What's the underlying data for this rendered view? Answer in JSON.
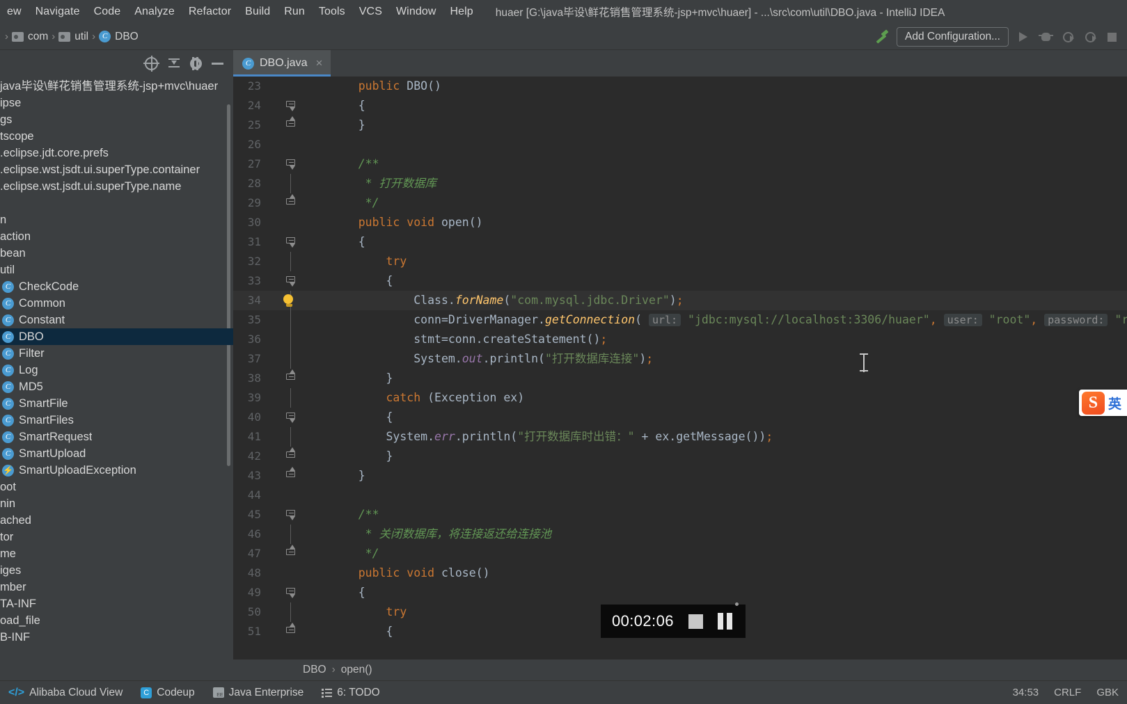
{
  "window": {
    "title": "huaer [G:\\java毕设\\鲜花销售管理系统-jsp+mvc\\huaer] - ...\\src\\com\\util\\DBO.java - IntelliJ IDEA"
  },
  "menubar": {
    "items": [
      {
        "label": "ew"
      },
      {
        "label": "Navigate"
      },
      {
        "label": "Code"
      },
      {
        "label": "Analyze"
      },
      {
        "label": "Refactor"
      },
      {
        "label": "Build"
      },
      {
        "label": "Run"
      },
      {
        "label": "Tools"
      },
      {
        "label": "VCS"
      },
      {
        "label": "Window"
      },
      {
        "label": "Help"
      }
    ]
  },
  "breadcrumb": {
    "items": [
      {
        "label": "com",
        "icon": "folder-icon"
      },
      {
        "label": "util",
        "icon": "folder-icon"
      },
      {
        "label": "DBO",
        "icon": "java-class-icon"
      }
    ]
  },
  "toolbar": {
    "build_icon": "hammer-icon",
    "add_configuration_label": "Add Configuration...",
    "run_icon": "run-icon",
    "debug_icon": "debug-icon",
    "run_with_coverage_icon": "run-coverage-icon",
    "profile_icon": "profile-icon",
    "stop_icon": "stop-icon"
  },
  "project_panel": {
    "toolbar_icons": [
      "locate-icon",
      "collapse-all-icon",
      "gear-icon",
      "hide-icon"
    ],
    "tree": [
      {
        "label": "java毕设\\鲜花销售管理系统-jsp+mvc\\huaer",
        "type": "root",
        "selected": false
      },
      {
        "label": "ipse",
        "type": "folder",
        "selected": false
      },
      {
        "label": "gs",
        "type": "folder",
        "selected": false
      },
      {
        "label": "tscope",
        "type": "file",
        "selected": false
      },
      {
        "label": ".eclipse.jdt.core.prefs",
        "type": "file",
        "selected": false
      },
      {
        "label": ".eclipse.wst.jsdt.ui.superType.container",
        "type": "file",
        "selected": false
      },
      {
        "label": ".eclipse.wst.jsdt.ui.superType.name",
        "type": "file",
        "selected": false
      },
      {
        "label": "",
        "type": "blank",
        "selected": false
      },
      {
        "label": "n",
        "type": "folder",
        "selected": false
      },
      {
        "label": "action",
        "type": "folder",
        "selected": false
      },
      {
        "label": "bean",
        "type": "folder",
        "selected": false
      },
      {
        "label": "util",
        "type": "folder",
        "selected": false
      },
      {
        "label": "CheckCode",
        "type": "class",
        "selected": false
      },
      {
        "label": "Common",
        "type": "class",
        "selected": false
      },
      {
        "label": "Constant",
        "type": "class",
        "selected": false
      },
      {
        "label": "DBO",
        "type": "class",
        "selected": true
      },
      {
        "label": "Filter",
        "type": "class",
        "selected": false
      },
      {
        "label": "Log",
        "type": "class",
        "selected": false
      },
      {
        "label": "MD5",
        "type": "class",
        "selected": false
      },
      {
        "label": "SmartFile",
        "type": "class",
        "selected": false
      },
      {
        "label": "SmartFiles",
        "type": "class",
        "selected": false
      },
      {
        "label": "SmartRequest",
        "type": "class",
        "selected": false
      },
      {
        "label": "SmartUpload",
        "type": "class",
        "selected": false
      },
      {
        "label": "SmartUploadException",
        "type": "exception",
        "selected": false
      },
      {
        "label": "oot",
        "type": "folder",
        "selected": false
      },
      {
        "label": "nin",
        "type": "folder",
        "selected": false
      },
      {
        "label": "ached",
        "type": "folder",
        "selected": false
      },
      {
        "label": "tor",
        "type": "folder",
        "selected": false
      },
      {
        "label": "me",
        "type": "folder",
        "selected": false
      },
      {
        "label": "iges",
        "type": "folder",
        "selected": false
      },
      {
        "label": "mber",
        "type": "folder",
        "selected": false
      },
      {
        "label": "TA-INF",
        "type": "folder",
        "selected": false
      },
      {
        "label": "oad_file",
        "type": "folder",
        "selected": false
      },
      {
        "label": "B-INF",
        "type": "folder",
        "selected": false
      }
    ]
  },
  "editor": {
    "tab": {
      "label": "DBO.java",
      "icon": "java-class-icon",
      "close_icon": "close-icon"
    },
    "breadcrumb": {
      "class": "DBO",
      "separator": "›",
      "method": "open()"
    },
    "lines": [
      {
        "n": "23",
        "fold": "none",
        "hl": false,
        "tokens": [
          {
            "t": "    ",
            "c": "plain"
          },
          {
            "t": "public ",
            "c": "kw"
          },
          {
            "t": "DBO()",
            "c": "plain"
          }
        ]
      },
      {
        "n": "24",
        "fold": "open",
        "hl": false,
        "tokens": [
          {
            "t": "    {",
            "c": "plain"
          }
        ]
      },
      {
        "n": "25",
        "fold": "end",
        "hl": false,
        "tokens": [
          {
            "t": "    }",
            "c": "plain"
          }
        ]
      },
      {
        "n": "26",
        "fold": "none",
        "hl": false,
        "tokens": [
          {
            "t": "",
            "c": "plain"
          }
        ]
      },
      {
        "n": "27",
        "fold": "open",
        "hl": false,
        "tokens": [
          {
            "t": "    /**",
            "c": "cmt"
          }
        ]
      },
      {
        "n": "28",
        "fold": "line",
        "hl": false,
        "tokens": [
          {
            "t": "     * 打开数据库",
            "c": "cmt"
          }
        ]
      },
      {
        "n": "29",
        "fold": "end",
        "hl": false,
        "tokens": [
          {
            "t": "     */",
            "c": "cmt"
          }
        ]
      },
      {
        "n": "30",
        "fold": "none",
        "hl": false,
        "tokens": [
          {
            "t": "    ",
            "c": "plain"
          },
          {
            "t": "public void ",
            "c": "kw"
          },
          {
            "t": "open()",
            "c": "plain"
          }
        ]
      },
      {
        "n": "31",
        "fold": "open",
        "hl": false,
        "tokens": [
          {
            "t": "    {",
            "c": "plain"
          }
        ]
      },
      {
        "n": "32",
        "fold": "line",
        "hl": false,
        "tokens": [
          {
            "t": "        ",
            "c": "plain"
          },
          {
            "t": "try",
            "c": "kw"
          }
        ]
      },
      {
        "n": "33",
        "fold": "open",
        "hl": false,
        "tokens": [
          {
            "t": "        {",
            "c": "plain"
          }
        ]
      },
      {
        "n": "34",
        "fold": "bulb",
        "hl": true,
        "tokens": [
          {
            "t": "            Class.",
            "c": "plain"
          },
          {
            "t": "forName",
            "c": "ital"
          },
          {
            "t": "(",
            "c": "plain"
          },
          {
            "t": "\"com.mysql.jdbc.Driver\"",
            "c": "str"
          },
          {
            "t": ")",
            "c": "plain"
          },
          {
            "t": ";",
            "c": "semi"
          }
        ]
      },
      {
        "n": "35",
        "fold": "line",
        "hl": false,
        "tokens": [
          {
            "t": "            conn=DriverManager.",
            "c": "plain"
          },
          {
            "t": "getConnection",
            "c": "ital"
          },
          {
            "t": "( ",
            "c": "plain"
          },
          {
            "t": "url:",
            "c": "hint"
          },
          {
            "t": " \"jdbc:mysql://localhost:3306/huaer\"",
            "c": "str"
          },
          {
            "t": ", ",
            "c": "semi"
          },
          {
            "t": "user:",
            "c": "hint"
          },
          {
            "t": " \"root\"",
            "c": "str"
          },
          {
            "t": ", ",
            "c": "semi"
          },
          {
            "t": "password:",
            "c": "hint"
          },
          {
            "t": " \"root\"",
            "c": "str"
          },
          {
            "t": ");",
            "c": "semi"
          }
        ]
      },
      {
        "n": "36",
        "fold": "line",
        "hl": false,
        "tokens": [
          {
            "t": "            stmt=conn.createStatement()",
            "c": "plain"
          },
          {
            "t": ";",
            "c": "semi"
          }
        ]
      },
      {
        "n": "37",
        "fold": "line",
        "hl": false,
        "tokens": [
          {
            "t": "            System.",
            "c": "plain"
          },
          {
            "t": "out",
            "c": "fldital"
          },
          {
            "t": ".println(",
            "c": "plain"
          },
          {
            "t": "\"打开数据库连接\"",
            "c": "str"
          },
          {
            "t": ")",
            "c": "plain"
          },
          {
            "t": ";",
            "c": "semi"
          }
        ]
      },
      {
        "n": "38",
        "fold": "end",
        "hl": false,
        "tokens": [
          {
            "t": "        }",
            "c": "plain"
          }
        ]
      },
      {
        "n": "39",
        "fold": "line",
        "hl": false,
        "tokens": [
          {
            "t": "        ",
            "c": "plain"
          },
          {
            "t": "catch",
            "c": "kw"
          },
          {
            "t": " (Exception ex)",
            "c": "plain"
          }
        ]
      },
      {
        "n": "40",
        "fold": "open",
        "hl": false,
        "tokens": [
          {
            "t": "        {",
            "c": "plain"
          }
        ]
      },
      {
        "n": "41",
        "fold": "line",
        "hl": false,
        "tokens": [
          {
            "t": "        System.",
            "c": "plain"
          },
          {
            "t": "err",
            "c": "fldital"
          },
          {
            "t": ".println(",
            "c": "plain"
          },
          {
            "t": "\"打开数据库时出错：\"",
            "c": "str"
          },
          {
            "t": " + ex.getMessage())",
            "c": "plain"
          },
          {
            "t": ";",
            "c": "semi"
          }
        ]
      },
      {
        "n": "42",
        "fold": "end",
        "hl": false,
        "tokens": [
          {
            "t": "        }",
            "c": "plain"
          }
        ]
      },
      {
        "n": "43",
        "fold": "end",
        "hl": false,
        "tokens": [
          {
            "t": "    }",
            "c": "plain"
          }
        ]
      },
      {
        "n": "44",
        "fold": "none",
        "hl": false,
        "tokens": [
          {
            "t": "",
            "c": "plain"
          }
        ]
      },
      {
        "n": "45",
        "fold": "open",
        "hl": false,
        "tokens": [
          {
            "t": "    /**",
            "c": "cmt"
          }
        ]
      },
      {
        "n": "46",
        "fold": "line",
        "hl": false,
        "tokens": [
          {
            "t": "     * 关闭数据库，将连接返还给连接池",
            "c": "cmt"
          }
        ]
      },
      {
        "n": "47",
        "fold": "end",
        "hl": false,
        "tokens": [
          {
            "t": "     */",
            "c": "cmt"
          }
        ]
      },
      {
        "n": "48",
        "fold": "none",
        "hl": false,
        "tokens": [
          {
            "t": "    ",
            "c": "plain"
          },
          {
            "t": "public void ",
            "c": "kw"
          },
          {
            "t": "close()",
            "c": "plain"
          }
        ]
      },
      {
        "n": "49",
        "fold": "open",
        "hl": false,
        "tokens": [
          {
            "t": "    {",
            "c": "plain"
          }
        ]
      },
      {
        "n": "50",
        "fold": "line",
        "hl": false,
        "tokens": [
          {
            "t": "        ",
            "c": "plain"
          },
          {
            "t": "try",
            "c": "kw"
          }
        ]
      },
      {
        "n": "51",
        "fold": "end",
        "hl": false,
        "tokens": [
          {
            "t": "        {",
            "c": "plain"
          }
        ]
      }
    ]
  },
  "statusbar": {
    "items": [
      {
        "label": "Alibaba Cloud View",
        "icon": "alibaba-cloud-icon"
      },
      {
        "label": "Codeup",
        "icon": "codeup-icon"
      },
      {
        "label": "Java Enterprise",
        "icon": "java-enterprise-icon"
      },
      {
        "label": "6: TODO",
        "icon": "todo-icon"
      }
    ],
    "caret_position": "34:53",
    "line_separator": "CRLF",
    "encoding": "GBK"
  },
  "recorder": {
    "elapsed": "00:02:06",
    "stop_icon": "stop-icon",
    "pause_icon": "pause-icon"
  },
  "ime": {
    "logo_letter": "S",
    "mode_label": "英"
  },
  "colors": {
    "accent": "#4a88c7",
    "selection": "#0d293e",
    "editor_bg": "#2b2b2b",
    "chrome_bg": "#3c3f41",
    "string": "#6a8759",
    "keyword": "#cc7832",
    "comment": "#629755"
  }
}
